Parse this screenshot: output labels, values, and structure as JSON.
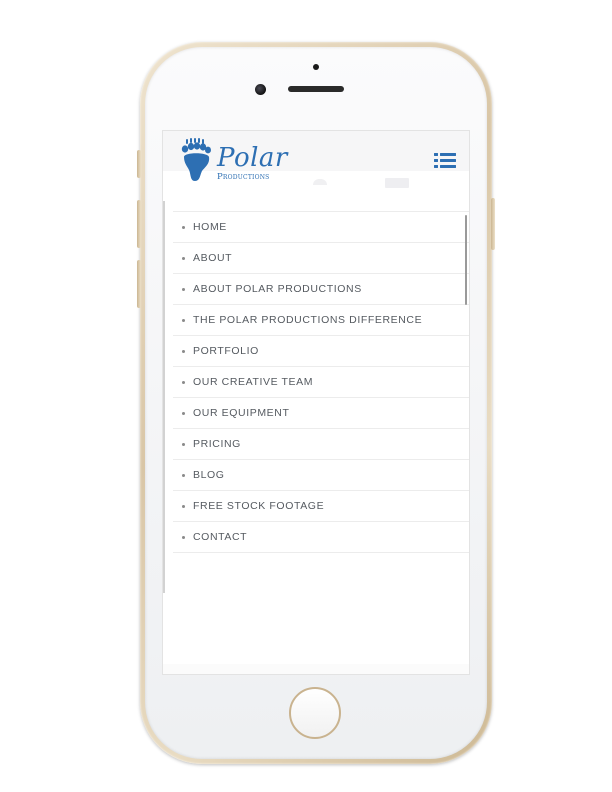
{
  "device": {
    "frame_color": "#d9c6a6",
    "screen_bg": "#ffffff"
  },
  "header": {
    "logo_text": "Polar",
    "logo_subtext": "Productions",
    "logo_color": "#2d6fb3",
    "logo_icon": "bear-paw-icon",
    "menu_icon": "list-menu-icon",
    "menu_icon_color": "#2d6fb3"
  },
  "nav": {
    "items": [
      {
        "label": "HOME"
      },
      {
        "label": "ABOUT"
      },
      {
        "label": "ABOUT POLAR PRODUCTIONS"
      },
      {
        "label": "THE POLAR PRODUCTIONS DIFFERENCE"
      },
      {
        "label": "PORTFOLIO"
      },
      {
        "label": "OUR CREATIVE TEAM"
      },
      {
        "label": "OUR EQUIPMENT"
      },
      {
        "label": "PRICING"
      },
      {
        "label": "BLOG"
      },
      {
        "label": "FREE STOCK FOOTAGE"
      },
      {
        "label": "CONTACT"
      }
    ],
    "text_color": "#555a60",
    "divider_color": "#ececec"
  }
}
